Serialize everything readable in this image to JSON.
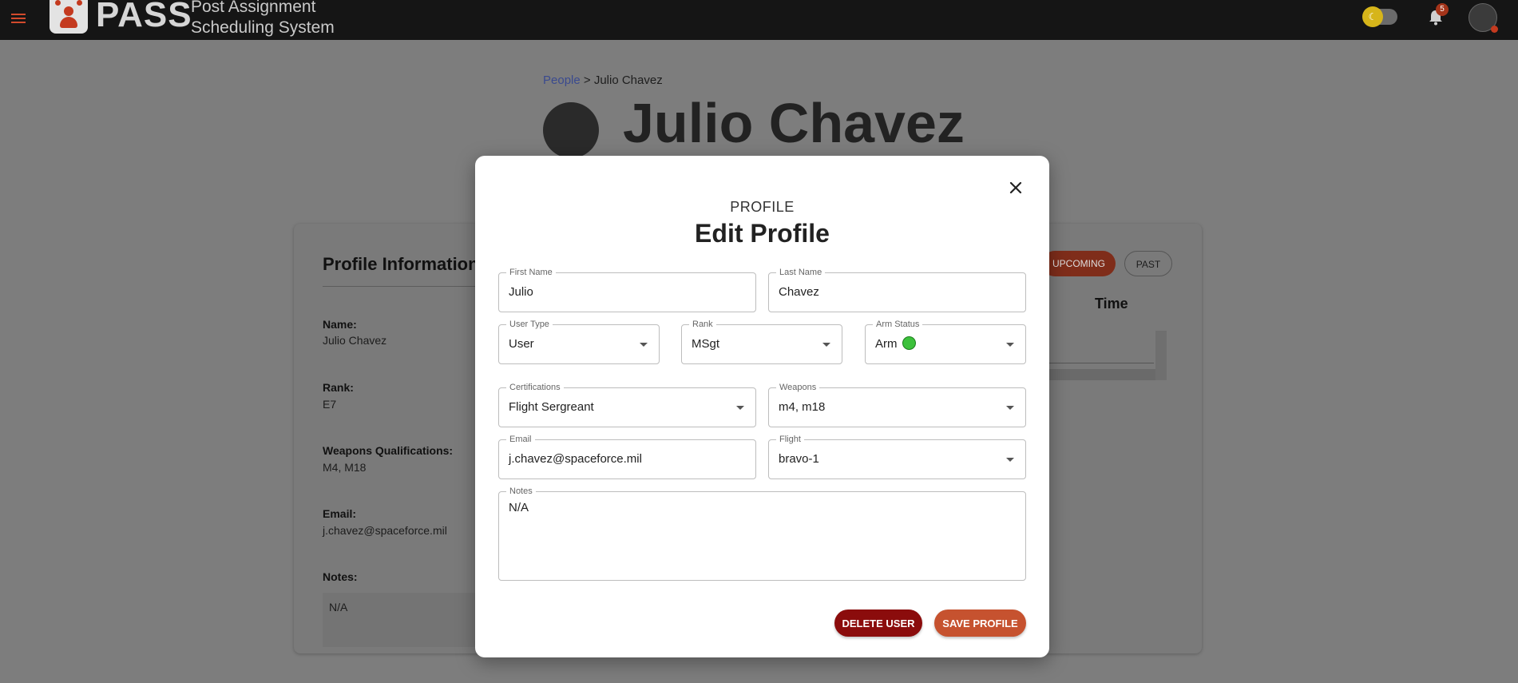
{
  "topbar": {
    "brand": "PASS",
    "subtitle_line1": "Post Assignment",
    "subtitle_line2": "Scheduling System",
    "notification_count": "5",
    "theme_toggle_icon": "moon-icon"
  },
  "breadcrumb": {
    "parent": "People",
    "separator": ">",
    "current": "Julio Chavez"
  },
  "person": {
    "name": "Julio Chavez"
  },
  "profile_card": {
    "title": "Profile Information",
    "name_label": "Name:",
    "name_value": "Julio Chavez",
    "rank_label": "Rank:",
    "rank_value": "E7",
    "weapons_label": "Weapons Qualifications:",
    "weapons_value": "M4, M18",
    "email_label": "Email:",
    "email_value": "j.chavez@spaceforce.mil",
    "notes_label": "Notes:",
    "notes_value": "N/A"
  },
  "schedule_card": {
    "upcoming_label": "UPCOMING",
    "past_label": "PAST",
    "time_column": "Time"
  },
  "modal": {
    "eyebrow": "PROFILE",
    "title": "Edit Profile",
    "fields": {
      "first_name": {
        "label": "First Name",
        "value": "Julio"
      },
      "last_name": {
        "label": "Last Name",
        "value": "Chavez"
      },
      "user_type": {
        "label": "User Type",
        "value": "User"
      },
      "rank": {
        "label": "Rank",
        "value": "MSgt"
      },
      "arm_status": {
        "label": "Arm Status",
        "value": "Arm",
        "indicator_color": "#3cc13b"
      },
      "certifications": {
        "label": "Certifications",
        "value": "Flight Sergreant"
      },
      "weapons": {
        "label": "Weapons",
        "value": "m4, m18"
      },
      "email": {
        "label": "Email",
        "value": "j.chavez@spaceforce.mil"
      },
      "flight": {
        "label": "Flight",
        "value": "bravo-1"
      },
      "notes": {
        "label": "Notes",
        "value": "N/A"
      }
    },
    "delete_label": "DELETE USER",
    "save_label": "SAVE PROFILE"
  },
  "colors": {
    "accent": "#c6522f",
    "danger": "#8b0c0c",
    "topbar": "#151515"
  }
}
